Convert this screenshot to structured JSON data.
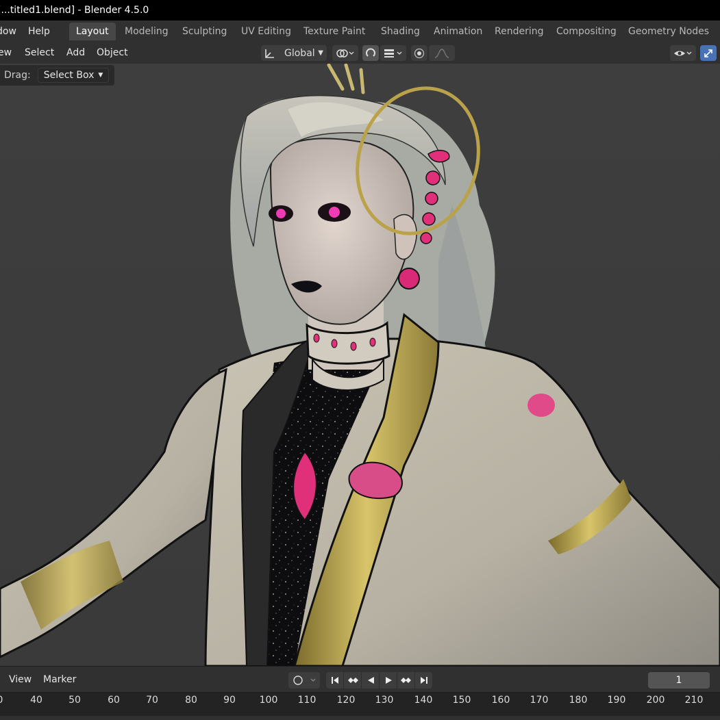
{
  "window": {
    "title": "[...titled1.blend] - Blender 4.5.0"
  },
  "topbar": {
    "menus": [
      "dow",
      "Help"
    ],
    "workspaces": [
      {
        "label": "Layout",
        "active": true
      },
      {
        "label": "Modeling"
      },
      {
        "label": "Sculpting"
      },
      {
        "label": "UV Editing"
      },
      {
        "label": "Texture Paint"
      },
      {
        "label": "Shading"
      },
      {
        "label": "Animation"
      },
      {
        "label": "Rendering"
      },
      {
        "label": "Compositing"
      },
      {
        "label": "Geometry Nodes"
      }
    ]
  },
  "viewport_header": {
    "menus": [
      "ew",
      "Select",
      "Add",
      "Object"
    ],
    "transform_orientation": "Global",
    "icons": [
      "orientation-icon",
      "pivot-icon",
      "snap-icon",
      "snap-increment-icon",
      "proportional-icon",
      "falloff-icon",
      "visibility-icon",
      "gizmo-icon"
    ]
  },
  "tool_settings": {
    "drag_label": "Drag:",
    "drag_value": "Select Box"
  },
  "timeline": {
    "menus": [
      "View",
      "Marker"
    ],
    "current_frame": "1",
    "ruler_ticks": [
      "0",
      "40",
      "50",
      "60",
      "70",
      "80",
      "90",
      "100",
      "110",
      "120",
      "130",
      "140",
      "150",
      "160",
      "170",
      "180",
      "190",
      "200",
      "210"
    ]
  },
  "colors": {
    "active_blue": "#4772b3",
    "accent_pink": "#e8307f",
    "gold": "#b9a24a"
  }
}
